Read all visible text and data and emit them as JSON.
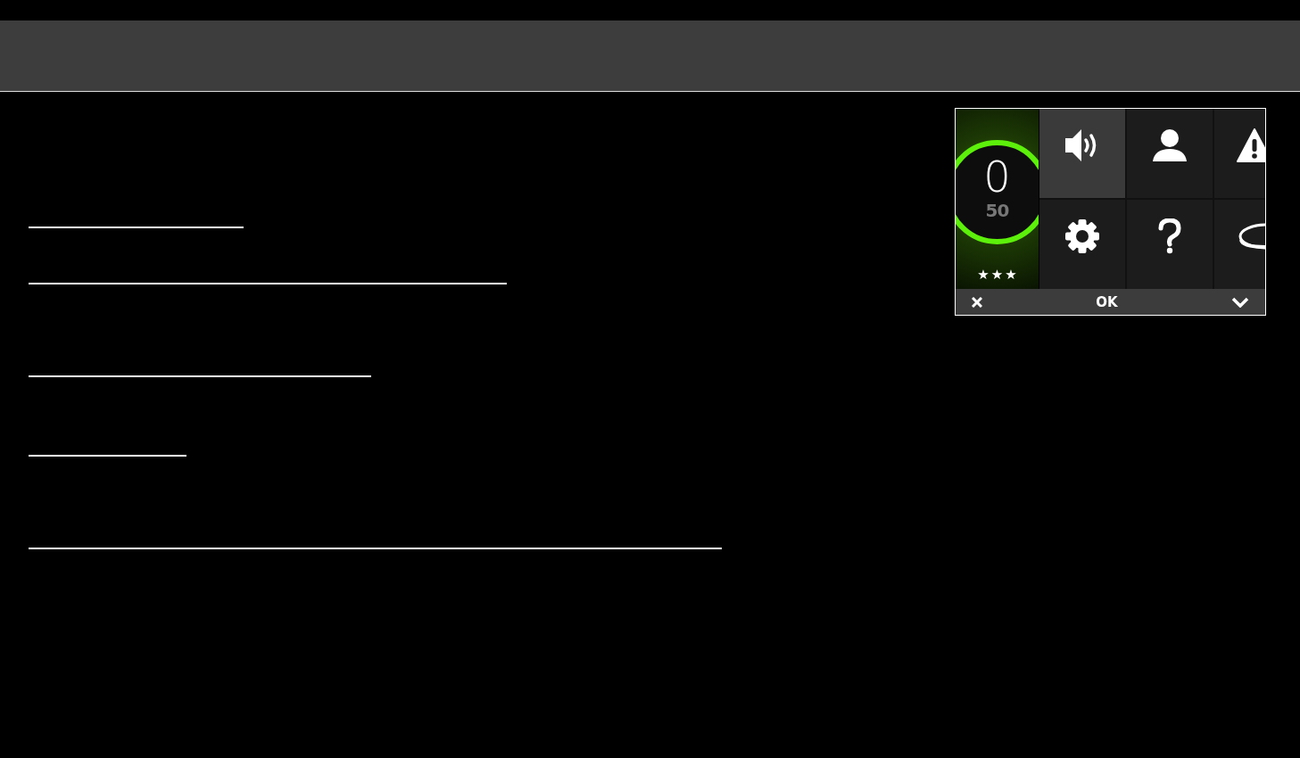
{
  "gauge": {
    "value": "0",
    "target": "50",
    "stars": 3
  },
  "tiles": [
    {
      "kind": "speaker",
      "selected": true
    },
    {
      "kind": "person",
      "selected": false
    },
    {
      "kind": "warning",
      "selected": false
    },
    {
      "kind": "gear",
      "selected": false
    },
    {
      "kind": "help",
      "selected": false
    },
    {
      "kind": "disc",
      "selected": false
    }
  ],
  "footer": {
    "ok": "OK"
  }
}
